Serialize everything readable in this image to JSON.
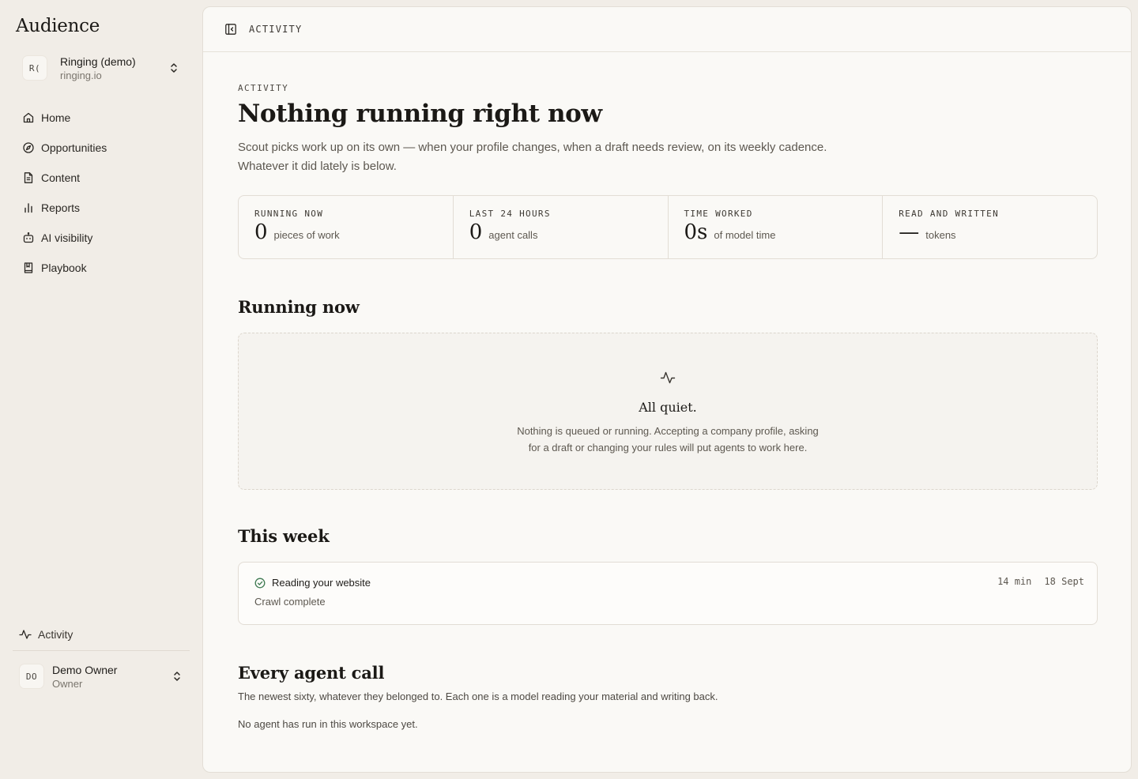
{
  "app": {
    "name": "Audience"
  },
  "workspace": {
    "initials": "R(",
    "name": "Ringing (demo)",
    "domain": "ringing.io"
  },
  "nav": {
    "items": [
      {
        "label": "Home",
        "icon": "home-icon"
      },
      {
        "label": "Opportunities",
        "icon": "compass-icon"
      },
      {
        "label": "Content",
        "icon": "document-icon"
      },
      {
        "label": "Reports",
        "icon": "bar-chart-icon"
      },
      {
        "label": "AI visibility",
        "icon": "robot-icon"
      },
      {
        "label": "Playbook",
        "icon": "book-icon"
      }
    ]
  },
  "activity_link": {
    "label": "Activity",
    "icon": "pulse-icon"
  },
  "user": {
    "initials": "DO",
    "name": "Demo Owner",
    "role": "Owner"
  },
  "topbar": {
    "title": "ACTIVITY"
  },
  "page": {
    "eyebrow": "ACTIVITY",
    "title": "Nothing running right now",
    "lede_1": "Scout picks work up on its own — when your profile changes, when a draft needs review, on its weekly cadence.",
    "lede_2": "Whatever it did lately is below."
  },
  "stats": [
    {
      "label": "RUNNING NOW",
      "value": "0",
      "unit": "pieces of work"
    },
    {
      "label": "LAST 24 HOURS",
      "value": "0",
      "unit": "agent calls"
    },
    {
      "label": "TIME WORKED",
      "value": "0s",
      "unit": "of model time"
    },
    {
      "label": "READ AND WRITTEN",
      "value": "—",
      "unit": "tokens"
    }
  ],
  "running": {
    "heading": "Running now",
    "empty_title": "All quiet.",
    "empty_text_1": "Nothing is queued or running. Accepting a company profile, asking",
    "empty_text_2": "for a draft or changing your rules will put agents to work here."
  },
  "week": {
    "heading": "This week",
    "items": [
      {
        "title": "Reading your website",
        "subtitle": "Crawl complete",
        "duration": "14 min",
        "date": "18 Sept",
        "status": "complete"
      }
    ]
  },
  "calls": {
    "heading": "Every agent call",
    "subtitle": "The newest sixty, whatever they belonged to. Each one is a model reading your material and writing back.",
    "empty": "No agent has run in this workspace yet."
  },
  "colors": {
    "background": "#f1ede7",
    "panel": "#faf9f6",
    "success": "#3f7a52"
  }
}
